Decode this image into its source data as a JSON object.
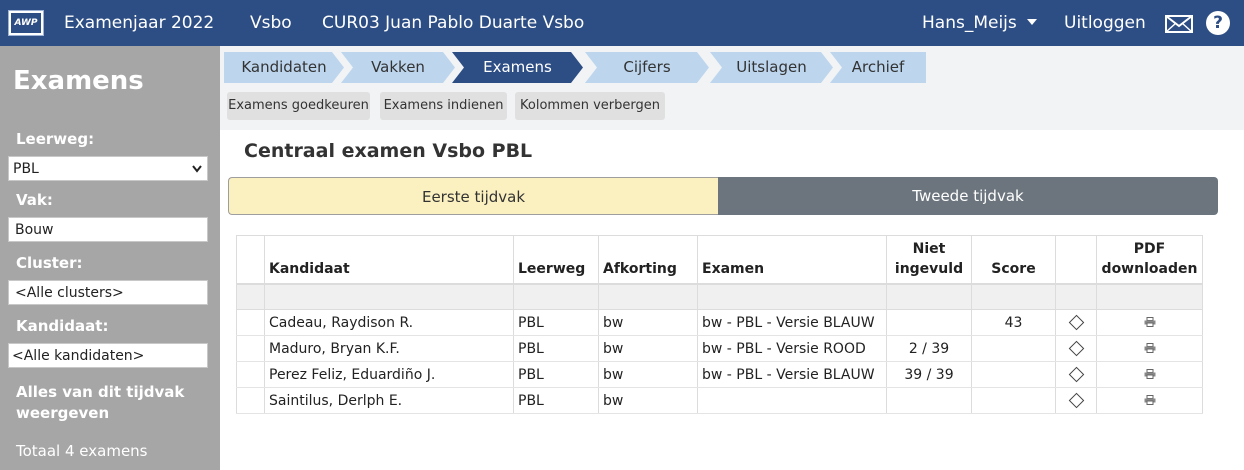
{
  "header": {
    "logo_text": "AWP",
    "exam_year": "Examenjaar 2022",
    "department": "Vsbo",
    "school": "CUR03 Juan Pablo Duarte Vsbo",
    "user": "Hans_Meijs",
    "logout": "Uitloggen",
    "icons": [
      "mail-icon",
      "help-icon"
    ]
  },
  "sidebar": {
    "title": "Examens",
    "leerweg_label": "Leerweg:",
    "leerweg_value": "PBL",
    "vak_label": "Vak:",
    "vak_value": "Bouw",
    "cluster_label": "Cluster:",
    "cluster_value": "<Alle clusters>",
    "kandidaat_label": "Kandidaat:",
    "kandidaat_value": "<Alle kandidaten>",
    "show_all": "Alles van dit tijdvak weergeven",
    "total": "Totaal 4 examens"
  },
  "breadcrumbs": [
    "Kandidaten",
    "Vakken",
    "Examens",
    "Cijfers",
    "Uitslagen",
    "Archief"
  ],
  "active_crumb": "Examens",
  "toolbar": {
    "approve": "Examens goedkeuren",
    "submit": "Examens indienen",
    "hide_columns": "Kolommen verbergen"
  },
  "main": {
    "heading": "Centraal examen Vsbo PBL",
    "tab_first": "Eerste tijdvak",
    "tab_second": "Tweede tijdvak"
  },
  "table": {
    "headers": {
      "kandidaat": "Kandidaat",
      "leerweg": "Leerweg",
      "afkorting": "Afkorting",
      "examen": "Examen",
      "niet_ingevuld_1": "Niet",
      "niet_ingevuld_2": "ingevuld",
      "score": "Score",
      "pdf_1": "PDF",
      "pdf_2": "downloaden"
    },
    "rows": [
      {
        "kandidaat": "Cadeau, Raydison R.",
        "leerweg": "PBL",
        "afkorting": "bw",
        "examen": "bw - PBL - Versie BLAUW",
        "niet_ingevuld": "",
        "score": "43"
      },
      {
        "kandidaat": "Maduro, Bryan K.F.",
        "leerweg": "PBL",
        "afkorting": "bw",
        "examen": "bw - PBL - Versie ROOD",
        "niet_ingevuld": "2 / 39",
        "score": ""
      },
      {
        "kandidaat": "Perez Feliz, Eduardiño J.",
        "leerweg": "PBL",
        "afkorting": "bw",
        "examen": "bw - PBL - Versie BLAUW",
        "niet_ingevuld": "39 / 39",
        "score": ""
      },
      {
        "kandidaat": "Saintilus, Derlph E.",
        "leerweg": "PBL",
        "afkorting": "bw",
        "examen": "",
        "niet_ingevuld": "",
        "score": ""
      }
    ]
  }
}
